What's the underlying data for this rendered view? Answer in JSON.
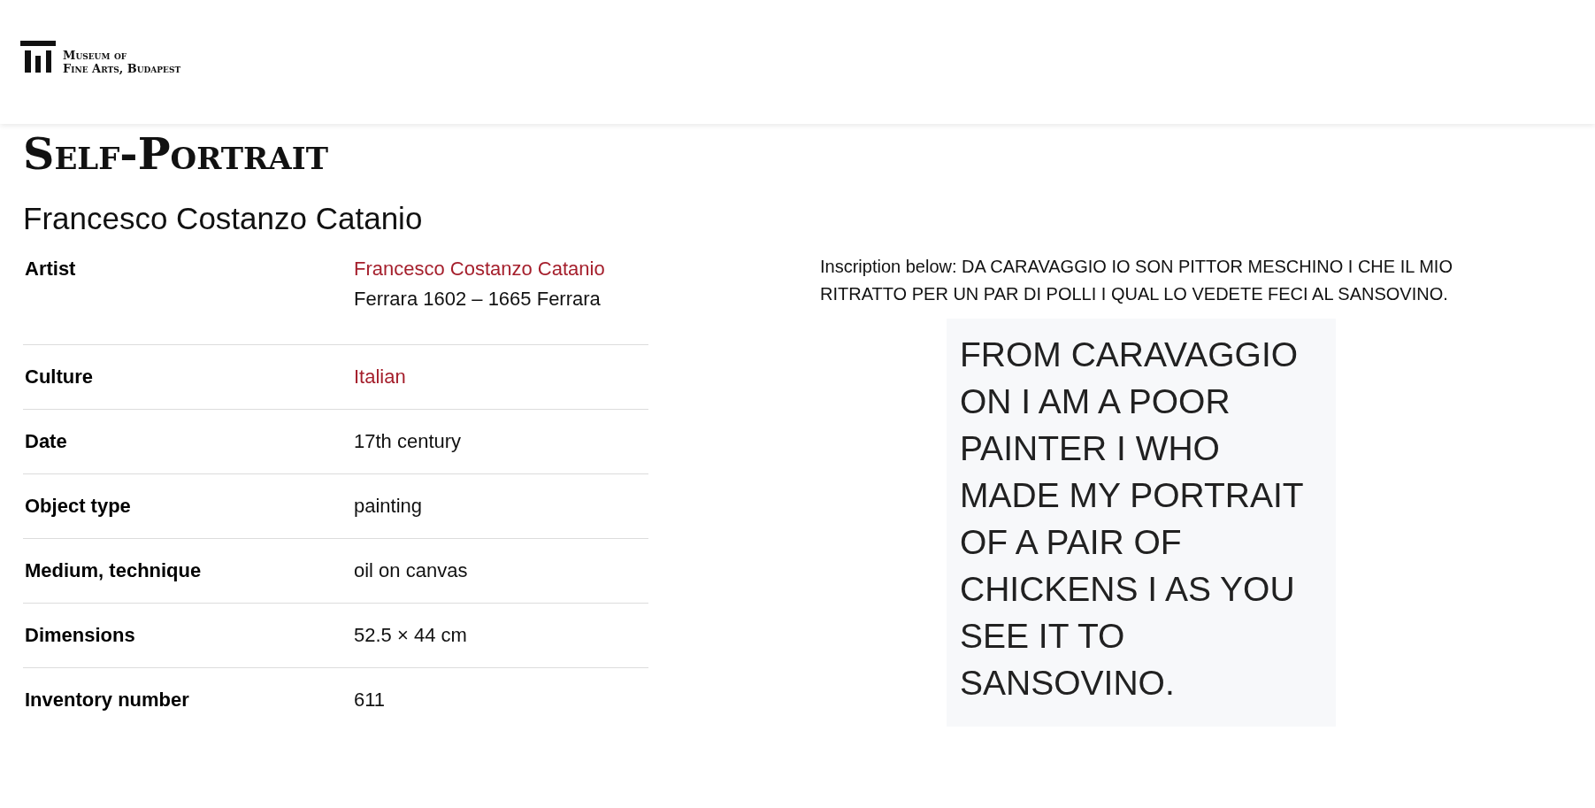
{
  "header": {
    "logo_lines": [
      "Museum of",
      "Fine Arts, Budapest"
    ]
  },
  "title": "Self-Portrait",
  "subtitle": "Francesco Costanzo Catanio",
  "details": [
    {
      "label": "Artist",
      "values": [
        {
          "kind": "link",
          "text": "Francesco Costanzo Catanio"
        },
        {
          "kind": "text",
          "text": "Ferrara 1602 – 1665 Ferrara"
        }
      ]
    },
    {
      "label": "Culture",
      "values": [
        {
          "kind": "link",
          "text": "Italian"
        }
      ]
    },
    {
      "label": "Date",
      "values": [
        {
          "kind": "text",
          "text": "17th century"
        }
      ]
    },
    {
      "label": "Object type",
      "values": [
        {
          "kind": "text",
          "text": "painting"
        }
      ]
    },
    {
      "label": "Medium, technique",
      "values": [
        {
          "kind": "text",
          "text": "oil on canvas"
        }
      ]
    },
    {
      "label": "Dimensions",
      "values": [
        {
          "kind": "text",
          "text": "52.5 × 44 cm"
        }
      ]
    },
    {
      "label": "Inventory number",
      "values": [
        {
          "kind": "text",
          "text": "611"
        }
      ]
    }
  ],
  "inscription": {
    "text": "Inscription below: DA CARAVAGGIO IO SON PITTOR MESCHINO I CHE IL MIO RITRATTO PER UN PAR DI POLLI I QUAL LO VEDETE FECI AL SANSOVINO.",
    "translation": "FROM CARAVAGGIO ON I AM A POOR PAINTER I WHO MADE MY PORTRAIT OF A PAIR OF CHICKENS I AS YOU SEE IT TO SANSOVINO."
  }
}
